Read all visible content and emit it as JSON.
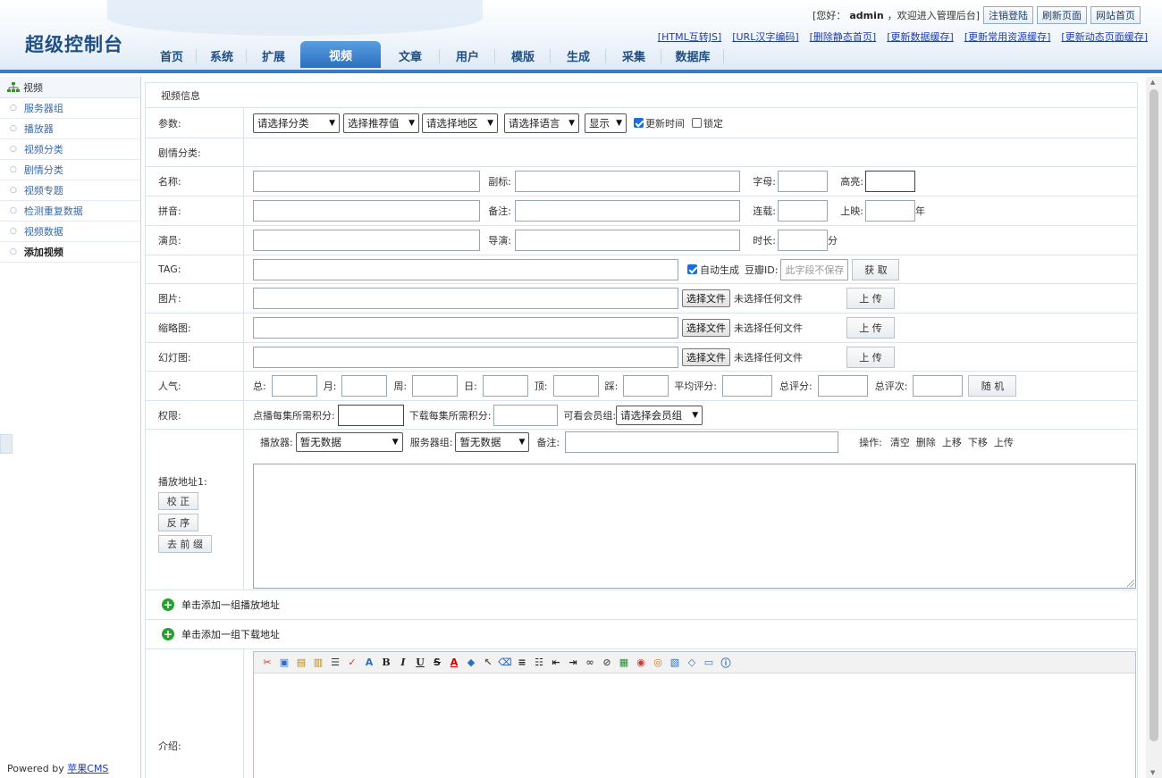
{
  "header": {
    "logo": "超级控制台",
    "greeting": "[您好：",
    "username": "admin",
    "greeting_tail": "，欢迎进入管理后台]",
    "buttons": [
      "注销登陆",
      "刷新页面",
      "网站首页"
    ],
    "tool_links": [
      "[HTML互转JS]",
      "[URL汉字编码]",
      "[删除静态首页]",
      "[更新数据缓存]",
      "[更新常用资源缓存]",
      "[更新动态页面缓存]"
    ],
    "nav": [
      "首页",
      "系统",
      "扩展",
      "视频",
      "文章",
      "用户",
      "模版",
      "生成",
      "采集",
      "数据库"
    ],
    "active_nav": "视频"
  },
  "sidebar": {
    "title": "视频",
    "items": [
      "服务器组",
      "播放器",
      "视频分类",
      "剧情分类",
      "视频专题",
      "检测重复数据",
      "视频数据",
      "添加视频"
    ],
    "active_item": "添加视频",
    "powered_prefix": "Powered by ",
    "powered_link": "苹果CMS"
  },
  "form": {
    "section_title": "视频信息",
    "params": {
      "label": "参数:",
      "selects": [
        "请选择分类",
        "选择推荐值",
        "请选择地区",
        "请选择语言",
        "显示"
      ],
      "update_time_label": "更新时间",
      "update_time_checked": true,
      "lock_label": "锁定",
      "lock_checked": false
    },
    "plot_category_label": "剧情分类:",
    "name_label": "名称:",
    "subtitle_label": "副标:",
    "letter_label": "字母:",
    "highlight_label": "高亮:",
    "pinyin_label": "拼音:",
    "remark_label": "备注:",
    "serial_label": "连载:",
    "release_label": "上映:",
    "year_unit": "年",
    "actor_label": "演员:",
    "director_label": "导演:",
    "duration_label": "时长:",
    "minute_unit": "分",
    "tag_label": "TAG:",
    "auto_generate_label": "自动生成",
    "auto_generate_checked": true,
    "douban_label": "豆瓣ID:",
    "douban_placeholder": "此字段不保存",
    "fetch_button": "获 取",
    "file_rows": [
      {
        "label": "图片:",
        "choose": "选择文件",
        "status": "未选择任何文件",
        "upload": "上 传"
      },
      {
        "label": "缩略图:",
        "choose": "选择文件",
        "status": "未选择任何文件",
        "upload": "上 传"
      },
      {
        "label": "幻灯图:",
        "choose": "选择文件",
        "status": "未选择任何文件",
        "upload": "上 传"
      }
    ],
    "popularity": {
      "label": "人气:",
      "fields": [
        "总:",
        "月:",
        "周:",
        "日:",
        "顶:",
        "踩:",
        "平均评分:",
        "总评分:",
        "总评次:"
      ],
      "random_button": "随 机"
    },
    "permission": {
      "label": "权限:",
      "play_points_label": "点播每集所需积分:",
      "download_points_label": "下载每集所需积分:",
      "group_label": "可看会员组:",
      "group_select": "请选择会员组"
    },
    "play_address": {
      "label": "播放地址1:",
      "buttons": [
        "校 正",
        "反 序",
        "去 前 缀"
      ],
      "player_label": "播放器:",
      "player_select": "暂无数据",
      "server_label": "服务器组:",
      "server_select": "暂无数据",
      "remark_label": "备注:",
      "ops_label": "操作:",
      "ops": [
        "清空",
        "删除",
        "上移",
        "下移",
        "上传"
      ]
    },
    "add_play_group": "单击添加一组播放地址",
    "add_download_group": "单击添加一组下载地址",
    "intro_label": "介绍:",
    "editor_tools": [
      "cut-icon",
      "copy-icon",
      "paste-icon",
      "paste-word-icon",
      "justify-icon",
      "spellcheck-icon",
      "font-icon",
      "bold-icon",
      "italic-icon",
      "underline-icon",
      "strikethrough-icon",
      "font-color-icon",
      "bg-color-icon",
      "cursor-icon",
      "eraser-icon",
      "align-icon",
      "list-icon",
      "outdent-icon",
      "indent-icon",
      "link-icon",
      "unlink-icon",
      "image-icon",
      "flash-icon",
      "media-icon",
      "table-icon",
      "source-icon",
      "preview-icon",
      "about-icon"
    ]
  }
}
